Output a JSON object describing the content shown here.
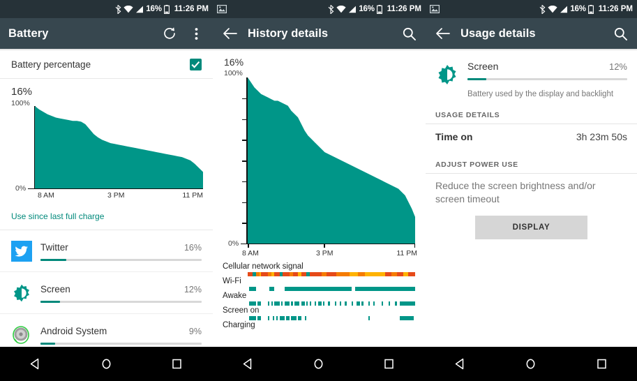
{
  "statusbar": {
    "battery_pct": "16%",
    "time": "11:26 PM",
    "icons": [
      "bluetooth-icon",
      "wifi-icon",
      "cell-signal-icon",
      "battery-icon"
    ],
    "notification_icon": "screenshot-image-icon"
  },
  "panel_battery": {
    "title": "Battery",
    "refresh_icon": "refresh-icon",
    "overflow_icon": "overflow-menu-icon",
    "battery_percentage_label": "Battery percentage",
    "battery_percentage_checked": true,
    "current_level": "16%",
    "link_label": "Use since last full charge",
    "apps": [
      {
        "name": "Twitter",
        "pct_label": "16%",
        "pct": 16,
        "icon": "twitter-icon"
      },
      {
        "name": "Screen",
        "pct_label": "12%",
        "pct": 12,
        "icon": "brightness-icon"
      },
      {
        "name": "Android System",
        "pct_label": "9%",
        "pct": 9,
        "icon": "android-system-icon"
      }
    ]
  },
  "panel_history": {
    "title": "History details",
    "back_icon": "back-arrow-icon",
    "search_icon": "search-icon",
    "current_level": "16%",
    "timeline_rows": [
      {
        "label": "Cellular network signal"
      },
      {
        "label": "Wi-Fi"
      },
      {
        "label": "Awake"
      },
      {
        "label": "Screen on"
      },
      {
        "label": "Charging"
      }
    ]
  },
  "panel_usage": {
    "title": "Usage details",
    "back_icon": "back-arrow-icon",
    "search_icon": "search-icon",
    "item_name": "Screen",
    "item_pct_label": "12%",
    "item_pct": 12,
    "item_icon": "brightness-icon",
    "item_description": "Battery used by the display and backlight",
    "usage_details_header": "USAGE DETAILS",
    "time_on_key": "Time on",
    "time_on_value": "3h 23m 50s",
    "adjust_power_header": "ADJUST POWER USE",
    "advice_text": "Reduce the screen brightness and/or screen timeout",
    "display_button": "DISPLAY"
  },
  "navbar": {
    "buttons": [
      "back-nav-icon",
      "home-nav-icon",
      "recents-nav-icon"
    ]
  },
  "colors": {
    "teal": "#009688",
    "teal_dark": "#00897B",
    "appbar": "#37474F",
    "statusbar": "#263238",
    "twitter_blue": "#1DA1F2",
    "signal_red": "#E64A19",
    "signal_orange": "#F57C00",
    "signal_amber": "#FFB300"
  },
  "chart_data": [
    {
      "type": "area",
      "id": "battery-mini-chart",
      "title": "16%",
      "xlabel": "",
      "ylabel": "",
      "ylim": [
        0,
        100
      ],
      "ytick_labels": [
        "100%",
        "0%"
      ],
      "xtick_labels": [
        "8 AM",
        "3 PM",
        "11 PM"
      ],
      "grid": false,
      "x": [
        0,
        1,
        2,
        3,
        4,
        5,
        6,
        7,
        8,
        9,
        10,
        11,
        12,
        13,
        14,
        15,
        16,
        17,
        18,
        19,
        20,
        21,
        22,
        23,
        24,
        25,
        26,
        27,
        28,
        29,
        30,
        31,
        32,
        33,
        34,
        35,
        36,
        37,
        38,
        39,
        40
      ],
      "values": [
        100,
        96,
        93,
        90,
        88,
        86,
        85,
        84,
        83,
        82,
        82,
        81,
        78,
        72,
        66,
        62,
        59,
        57,
        55,
        54,
        53,
        52,
        51,
        50,
        49,
        48,
        47,
        46,
        45,
        44,
        43,
        42,
        41,
        40,
        39,
        38,
        36,
        34,
        30,
        25,
        20
      ]
    },
    {
      "type": "area",
      "id": "battery-history-chart",
      "title": "16%",
      "xlabel": "",
      "ylabel": "",
      "ylim": [
        0,
        100
      ],
      "ytick_labels": [
        "100%",
        "0%"
      ],
      "xtick_labels": [
        "8 AM",
        "3 PM",
        "11 PM"
      ],
      "grid": false,
      "x": [
        0,
        1,
        2,
        3,
        4,
        5,
        6,
        7,
        8,
        9,
        10,
        11,
        12,
        13,
        14,
        15,
        16,
        17,
        18,
        19,
        20,
        21,
        22,
        23,
        24,
        25,
        26,
        27,
        28,
        29,
        30,
        31,
        32,
        33,
        34,
        35,
        36,
        37,
        38,
        39,
        40,
        41,
        42,
        43,
        44,
        45,
        46,
        47,
        48,
        49,
        50
      ],
      "values": [
        100,
        97,
        94,
        92,
        90,
        89,
        88,
        87,
        86,
        86,
        85,
        84,
        83,
        80,
        78,
        76,
        72,
        68,
        65,
        63,
        61,
        59,
        57,
        55,
        54,
        53,
        52,
        51,
        50,
        49,
        48,
        47,
        46,
        45,
        44,
        43,
        42,
        41,
        40,
        39,
        38,
        37,
        36,
        35,
        34,
        33,
        31,
        29,
        25,
        21,
        16
      ]
    }
  ],
  "timeline_data": {
    "cellular": [
      {
        "start": 0,
        "width": 3,
        "color": "#E64A19"
      },
      {
        "start": 3,
        "width": 2,
        "color": "#009688"
      },
      {
        "start": 5,
        "width": 2,
        "color": "#F57C00"
      },
      {
        "start": 7,
        "width": 1,
        "color": "#FFB300"
      },
      {
        "start": 8,
        "width": 4,
        "color": "#E64A19"
      },
      {
        "start": 12,
        "width": 2,
        "color": "#F57C00"
      },
      {
        "start": 14,
        "width": 2,
        "color": "#FFB300"
      },
      {
        "start": 16,
        "width": 3,
        "color": "#E64A19"
      },
      {
        "start": 19,
        "width": 2,
        "color": "#009688"
      },
      {
        "start": 21,
        "width": 4,
        "color": "#E64A19"
      },
      {
        "start": 25,
        "width": 2,
        "color": "#F57C00"
      },
      {
        "start": 27,
        "width": 3,
        "color": "#E64A19"
      },
      {
        "start": 30,
        "width": 2,
        "color": "#FFB300"
      },
      {
        "start": 32,
        "width": 3,
        "color": "#E64A19"
      },
      {
        "start": 35,
        "width": 2,
        "color": "#009688"
      },
      {
        "start": 37,
        "width": 7,
        "color": "#E64A19"
      },
      {
        "start": 44,
        "width": 3,
        "color": "#F57C00"
      },
      {
        "start": 47,
        "width": 6,
        "color": "#E64A19"
      },
      {
        "start": 53,
        "width": 8,
        "color": "#F57C00"
      },
      {
        "start": 61,
        "width": 5,
        "color": "#FFB300"
      },
      {
        "start": 66,
        "width": 4,
        "color": "#F57C00"
      },
      {
        "start": 70,
        "width": 12,
        "color": "#FFB300"
      },
      {
        "start": 82,
        "width": 4,
        "color": "#E64A19"
      },
      {
        "start": 86,
        "width": 3,
        "color": "#F57C00"
      },
      {
        "start": 89,
        "width": 4,
        "color": "#E64A19"
      },
      {
        "start": 93,
        "width": 3,
        "color": "#FFB300"
      },
      {
        "start": 96,
        "width": 4,
        "color": "#E64A19"
      }
    ],
    "wifi": [
      {
        "start": 1,
        "width": 4
      },
      {
        "start": 13,
        "width": 3
      },
      {
        "start": 22,
        "width": 40
      },
      {
        "start": 64,
        "width": 36
      }
    ],
    "awake": [
      {
        "start": 1,
        "width": 4
      },
      {
        "start": 6,
        "width": 2
      },
      {
        "start": 12,
        "width": 1
      },
      {
        "start": 14,
        "width": 1
      },
      {
        "start": 16,
        "width": 3
      },
      {
        "start": 20,
        "width": 1
      },
      {
        "start": 22,
        "width": 3
      },
      {
        "start": 26,
        "width": 1
      },
      {
        "start": 28,
        "width": 3
      },
      {
        "start": 32,
        "width": 2
      },
      {
        "start": 35,
        "width": 1
      },
      {
        "start": 37,
        "width": 1
      },
      {
        "start": 40,
        "width": 1
      },
      {
        "start": 42,
        "width": 2
      },
      {
        "start": 45,
        "width": 1
      },
      {
        "start": 48,
        "width": 1
      },
      {
        "start": 52,
        "width": 1
      },
      {
        "start": 55,
        "width": 1
      },
      {
        "start": 58,
        "width": 1
      },
      {
        "start": 62,
        "width": 1
      },
      {
        "start": 65,
        "width": 2
      },
      {
        "start": 68,
        "width": 1
      },
      {
        "start": 72,
        "width": 1
      },
      {
        "start": 75,
        "width": 1
      },
      {
        "start": 80,
        "width": 1
      },
      {
        "start": 84,
        "width": 1
      },
      {
        "start": 88,
        "width": 1
      },
      {
        "start": 91,
        "width": 9
      }
    ],
    "screen_on": [
      {
        "start": 1,
        "width": 4
      },
      {
        "start": 6,
        "width": 2
      },
      {
        "start": 12,
        "width": 1
      },
      {
        "start": 15,
        "width": 1
      },
      {
        "start": 17,
        "width": 1
      },
      {
        "start": 19,
        "width": 3
      },
      {
        "start": 23,
        "width": 2
      },
      {
        "start": 26,
        "width": 3
      },
      {
        "start": 30,
        "width": 2
      },
      {
        "start": 34,
        "width": 1
      },
      {
        "start": 72,
        "width": 1
      },
      {
        "start": 91,
        "width": 8
      }
    ],
    "charging": []
  }
}
